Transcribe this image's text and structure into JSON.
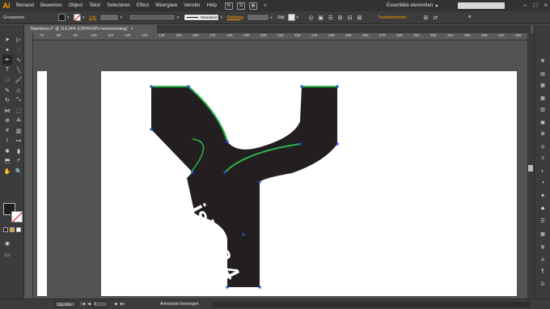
{
  "app": {
    "logo": "Ai"
  },
  "menu": [
    "Bestand",
    "Bewerken",
    "Object",
    "Tekst",
    "Selecteren",
    "Effect",
    "Weergave",
    "Venster",
    "Help"
  ],
  "menubar_icons": [
    "bridge-icon",
    "stock-icon",
    "arrange-icon",
    "gpu-icon",
    "send-icon"
  ],
  "workspace": {
    "label": "Essentiële elementen",
    "chevron": "▾"
  },
  "window_controls": [
    "–",
    "□",
    "×"
  ],
  "controlbar": {
    "selection_label": "Groeperen",
    "stroke_label": "Lijn",
    "stroke_style": "Standaard",
    "opacity_label": "Dekking",
    "style_label": "Stijl",
    "transform_label": "Transformeren"
  },
  "document_tab": {
    "title": "Naamloos-1* @ 119,34% (CMYK/GPU-voorvertoning)",
    "close": "×"
  },
  "ruler": {
    "ticks": [
      "70",
      "80",
      "90",
      "100",
      "110",
      "120",
      "130",
      "140",
      "150",
      "160",
      "170",
      "180",
      "190",
      "200",
      "210",
      "220",
      "230",
      "240",
      "250",
      "260",
      "270",
      "280",
      "290",
      "300",
      "310",
      "320",
      "330",
      "340",
      "350"
    ]
  },
  "artwork": {
    "text": "ision8.4",
    "fill_color": "#231f20",
    "edge_color": "#2bb34a",
    "anchor_color": "#1f4ed8"
  },
  "toolbar": {
    "tools": [
      "selection-tool",
      "direct-selection-tool",
      "magic-wand-tool",
      "lasso-tool",
      "pen-tool",
      "curvature-tool",
      "type-tool",
      "line-tool",
      "rectangle-tool",
      "paintbrush-tool",
      "pencil-tool",
      "eraser-tool",
      "rotate-tool",
      "scale-tool",
      "width-tool",
      "free-transform-tool",
      "shape-builder-tool",
      "perspective-tool",
      "mesh-tool",
      "gradient-tool",
      "eyedropper-tool",
      "blend-tool",
      "symbol-sprayer-tool",
      "graph-tool",
      "artboard-tool",
      "slice-tool",
      "hand-tool",
      "zoom-tool"
    ]
  },
  "status": {
    "zoom": "119,34%",
    "page": "1",
    "message": "Ankerpunt toevoegen"
  }
}
